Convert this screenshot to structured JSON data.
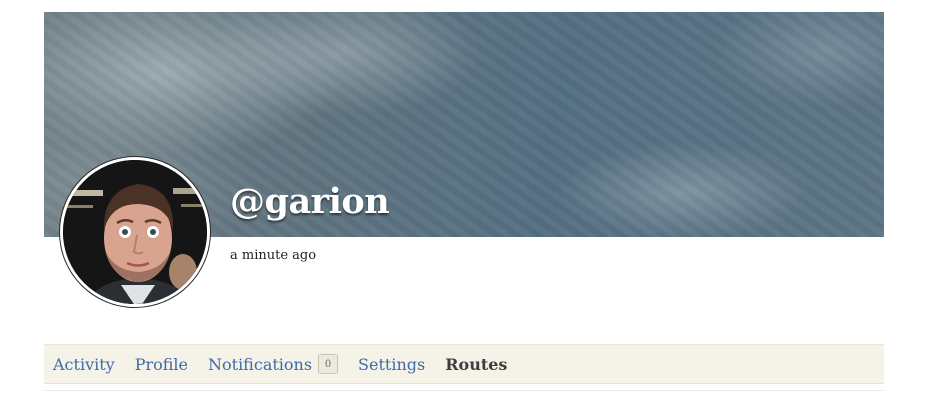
{
  "profile": {
    "username": "@garion",
    "last_seen": "a minute ago"
  },
  "tabs": [
    {
      "label": "Activity",
      "active": false
    },
    {
      "label": "Profile",
      "active": false
    },
    {
      "label": "Notifications",
      "active": false,
      "badge": "0"
    },
    {
      "label": "Settings",
      "active": false
    },
    {
      "label": "Routes",
      "active": true
    }
  ],
  "colors": {
    "tab_link": "#3d6aa8",
    "tab_active": "#3e3e3e",
    "tab_bar_bg": "#f5f3e7"
  }
}
